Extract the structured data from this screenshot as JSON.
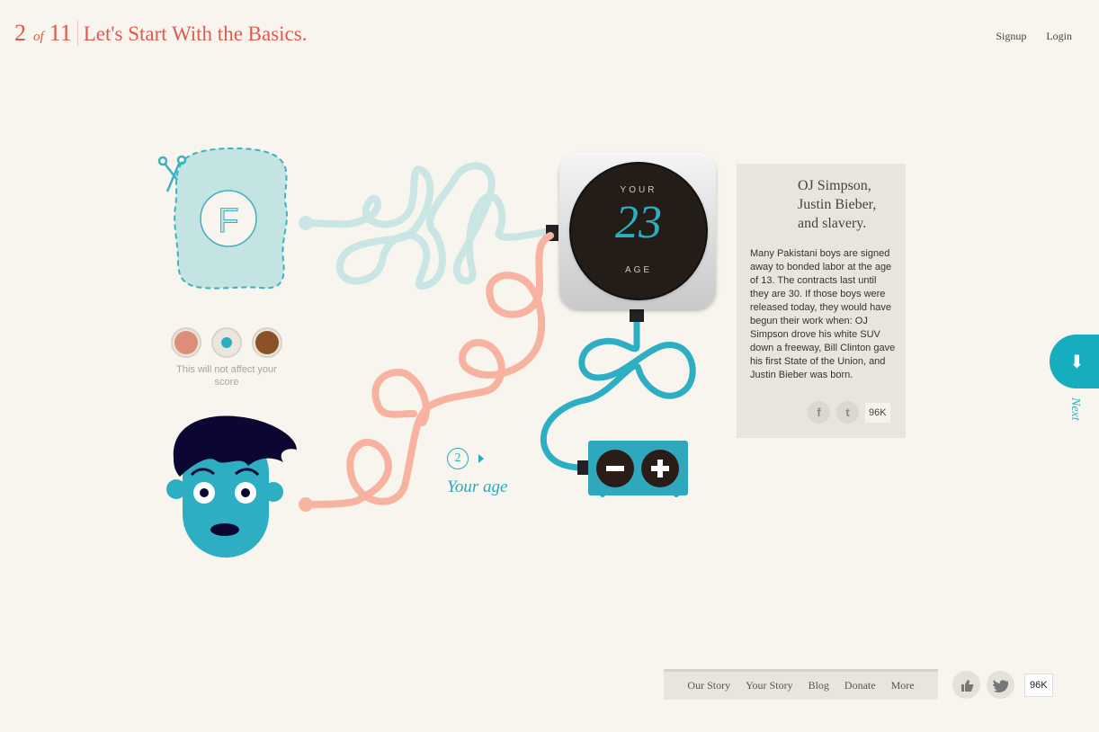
{
  "header": {
    "step_current": "2",
    "step_of": "of",
    "step_total": "11",
    "title": "Let's Start With the Basics."
  },
  "top_links": {
    "signup": "Signup",
    "login": "Login"
  },
  "grade_letter": "F",
  "skin_tone": {
    "options": [
      "#dc8e78",
      "#2eaec2",
      "#8b5127"
    ],
    "selected_index": 1,
    "note": "This will not affect your score"
  },
  "step": {
    "number": "2",
    "label": "Your age"
  },
  "age_dial": {
    "top_label": "YOUR",
    "value": "23",
    "bottom_label": "AGE"
  },
  "stepper": {
    "minus_icon": "minus-icon",
    "plus_icon": "plus-icon"
  },
  "fact_card": {
    "title": "OJ Simpson, Justin Bieber, and slavery.",
    "body": "Many Pakistani boys are signed away to bonded labor at the age of 13. The contracts last until they are 30. If those boys were released today, they would have begun their work when: OJ Simpson drove his white SUV down a freeway, Bill Clinton gave his first State of the Union, and Justin Bieber was born.",
    "share_count": "96K"
  },
  "next": {
    "label": "Next"
  },
  "footer": {
    "nav": [
      "Our Story",
      "Your Story",
      "Blog",
      "Donate",
      "More"
    ],
    "share_count": "96K"
  },
  "colors": {
    "accent_red": "#e0594b",
    "teal": "#2eaec2",
    "salmon_wire": "#f7b3a0",
    "light_wire": "#c9e5e4",
    "background": "#f7f5ee"
  }
}
